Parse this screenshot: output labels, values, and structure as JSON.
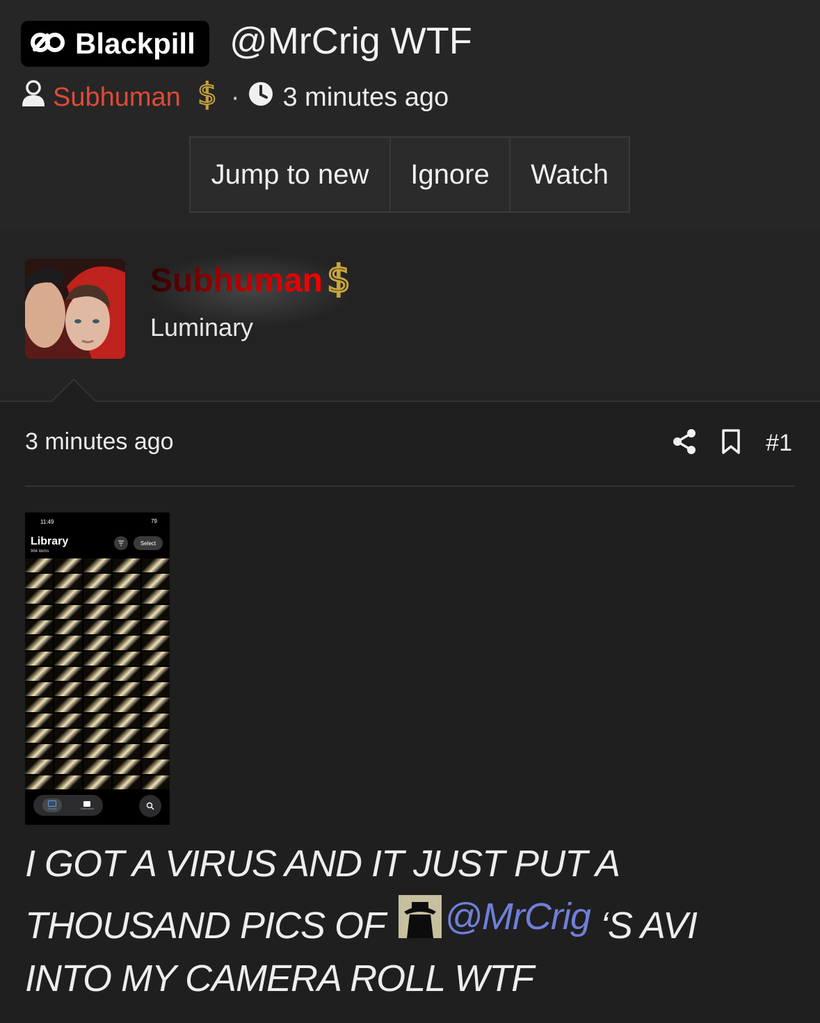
{
  "header": {
    "badge_label": "Blackpill",
    "thread_title": "@MrCrig WTF",
    "author": "Subhuman",
    "separator": "·",
    "time": "3 minutes ago",
    "buttons": [
      "Jump to new",
      "Ignore",
      "Watch"
    ]
  },
  "author_block": {
    "name": "Subhuman",
    "rank": "Luminary"
  },
  "post": {
    "time": "3 minutes ago",
    "number": "#1",
    "text_before": "I GOT A VIRUS AND IT JUST PUT A THOUSAND PICS OF",
    "mention": "@MrCrig",
    "text_after": "‘S AVI INTO MY CAMERA ROLL WTF"
  },
  "embedded_screenshot": {
    "status_time": "11:49",
    "battery": "79",
    "title": "Library",
    "subtitle": "964 Items",
    "select_label": "Select",
    "tab_library": "Library",
    "tab_collections": "Collections"
  },
  "colors": {
    "background": "#1f1f20",
    "header_bg": "#262627",
    "author_link": "#e04a35",
    "mention_link": "#6f7fd8",
    "gold": "#c9a43a"
  },
  "icons": [
    "blackpill-logo-icon",
    "user-icon",
    "dollar-icon",
    "clock-icon",
    "share-icon",
    "bookmark-icon",
    "search-icon"
  ]
}
